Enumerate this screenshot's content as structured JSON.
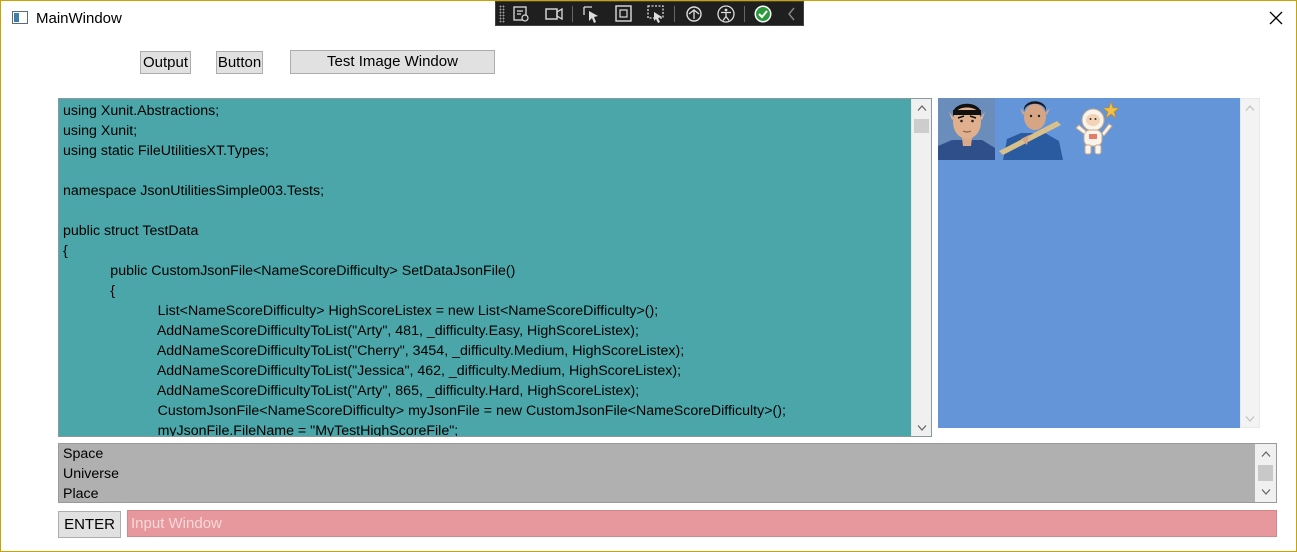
{
  "window": {
    "title": "MainWindow",
    "close_glyph": "×"
  },
  "debug_toolbar": {
    "tools": [
      "live-visual-tree-icon",
      "camera-icon",
      "select-element-icon",
      "display-layout-adorners-icon",
      "track-focused-element-icon",
      "hot-reload-icon",
      "accessibility-icon",
      "checkmark-icon",
      "collapse-chevron-icon"
    ]
  },
  "toolbar": {
    "output_label": "Output",
    "button_label": "Button",
    "test_image_window_label": "Test Image Window"
  },
  "code_editor": {
    "lines": [
      "using Xunit.Abstractions;",
      "using Xunit;",
      "using static FileUtilitiesXT.Types;",
      "",
      "namespace JsonUtilitiesSimple003.Tests;",
      "",
      "public struct TestData",
      "{",
      "            public CustomJsonFile<NameScoreDifficulty> SetDataJsonFile()",
      "            {",
      "                        List<NameScoreDifficulty> HighScoreListex = new List<NameScoreDifficulty>();",
      "                        AddNameScoreDifficultyToList(\"Arty\", 481, _difficulty.Easy, HighScoreListex);",
      "                        AddNameScoreDifficultyToList(\"Cherry\", 3454, _difficulty.Medium, HighScoreListex);",
      "                        AddNameScoreDifficultyToList(\"Jessica\", 462, _difficulty.Medium, HighScoreListex);",
      "                        AddNameScoreDifficultyToList(\"Arty\", 865, _difficulty.Hard, HighScoreListex);",
      "                        CustomJsonFile<NameScoreDifficulty> myJsonFile = new CustomJsonFile<NameScoreDifficulty>();",
      "                        myJsonFile.FileName = \"MyTestHighScoreFile\";"
    ],
    "background": "#4aa6a8"
  },
  "image_panel": {
    "background": "#6495d8",
    "images": [
      "spock-portrait-image",
      "spock-with-instrument-image",
      "astronaut-cartoon-image"
    ]
  },
  "list_box": {
    "items": [
      "Space",
      "Universe",
      "Place"
    ],
    "background": "#b0b0b0"
  },
  "input": {
    "placeholder": "Input Window",
    "value": "",
    "background": "#e6989c"
  },
  "enter_button": {
    "label": "ENTER"
  }
}
